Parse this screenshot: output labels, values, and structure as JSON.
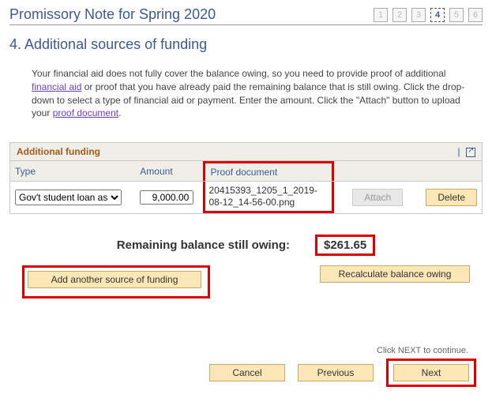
{
  "header": {
    "title": "Promissory Note for Spring 2020",
    "steps": [
      "1",
      "2",
      "3",
      "4",
      "5",
      "6"
    ],
    "active_step_index": 3
  },
  "section": {
    "heading": "4. Additional sources of funding",
    "intro_part1": "Your financial aid does not fully cover the balance owing, so you need to provide proof of additional ",
    "link1": "financial aid",
    "intro_part2": " or proof that you have already paid the remaining balance that is still owing. Click the drop-down to select a type of financial aid or payment. Enter the amount. Click the \"Attach\" button to upload your ",
    "link2": "proof document",
    "intro_part3": "."
  },
  "table": {
    "caption": "Additional funding",
    "cols": {
      "type": "Type",
      "amount": "Amount",
      "proof": "Proof document"
    },
    "row": {
      "type_selected": "Gov't student loan asses",
      "amount": "9,000.00",
      "proof_filename": "20415393_1205_1_2019-08-12_14-56-00.png",
      "attach_label": "Attach",
      "delete_label": "Delete"
    }
  },
  "remaining": {
    "label": "Remaining balance still owing:",
    "value": "$261.65"
  },
  "actions": {
    "add_label": "Add another source of funding",
    "recalc_label": "Recalculate balance owing"
  },
  "footer": {
    "hint": "Click NEXT to continue.",
    "cancel": "Cancel",
    "previous": "Previous",
    "next": "Next"
  }
}
